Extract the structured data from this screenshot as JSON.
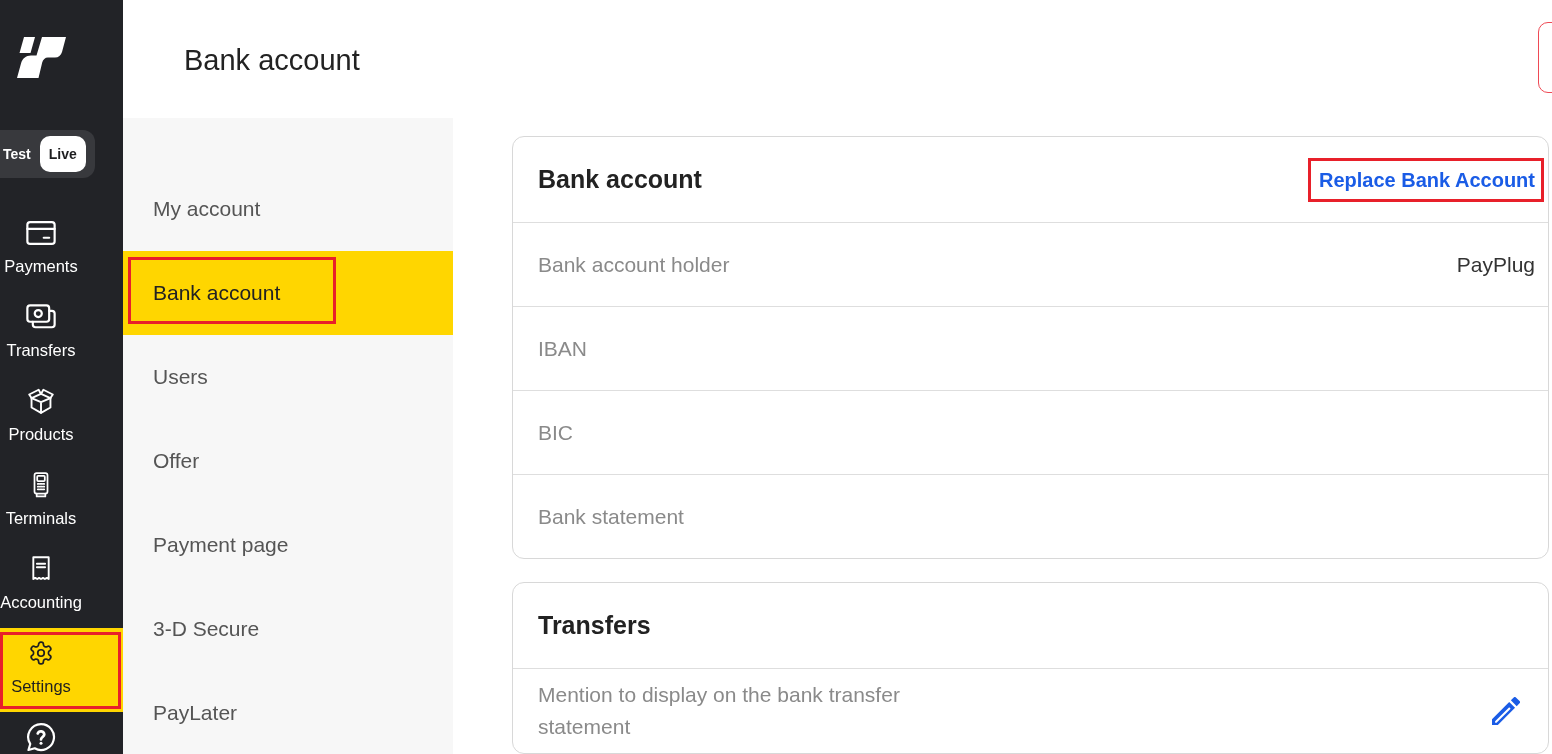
{
  "sidebar": {
    "mode_toggle": [
      {
        "label": "Test",
        "selected": false
      },
      {
        "label": "Live",
        "selected": true
      }
    ],
    "items": [
      {
        "label": "Payments",
        "selected": false,
        "highlighted": false
      },
      {
        "label": "Transfers",
        "selected": false,
        "highlighted": false
      },
      {
        "label": "Products",
        "selected": false,
        "highlighted": false
      },
      {
        "label": "Terminals",
        "selected": false,
        "highlighted": false
      },
      {
        "label": "Accounting",
        "selected": false,
        "highlighted": false
      },
      {
        "label": "Settings",
        "selected": true,
        "highlighted": true
      }
    ]
  },
  "header": {
    "title": "Bank account"
  },
  "settings_menu": {
    "items": [
      {
        "label": "My account",
        "selected": false,
        "highlighted": false
      },
      {
        "label": "Bank account",
        "selected": true,
        "highlighted": true
      },
      {
        "label": "Users",
        "selected": false,
        "highlighted": false
      },
      {
        "label": "Offer",
        "selected": false,
        "highlighted": false
      },
      {
        "label": "Payment page",
        "selected": false,
        "highlighted": false
      },
      {
        "label": "3-D Secure",
        "selected": false,
        "highlighted": false
      },
      {
        "label": "PayLater",
        "selected": false,
        "highlighted": false
      }
    ]
  },
  "bank_account_card": {
    "title": "Bank account",
    "action": {
      "label": "Replace Bank Account",
      "highlighted": true
    },
    "rows": [
      {
        "label": "Bank account holder",
        "value": "PayPlug"
      },
      {
        "label": "IBAN"
      },
      {
        "label": "BIC"
      },
      {
        "label": "Bank statement"
      }
    ]
  },
  "transfers_card": {
    "title": "Transfers",
    "rows": [
      {
        "label": "Mention to display on the bank transfer statement",
        "editable": true
      }
    ]
  }
}
